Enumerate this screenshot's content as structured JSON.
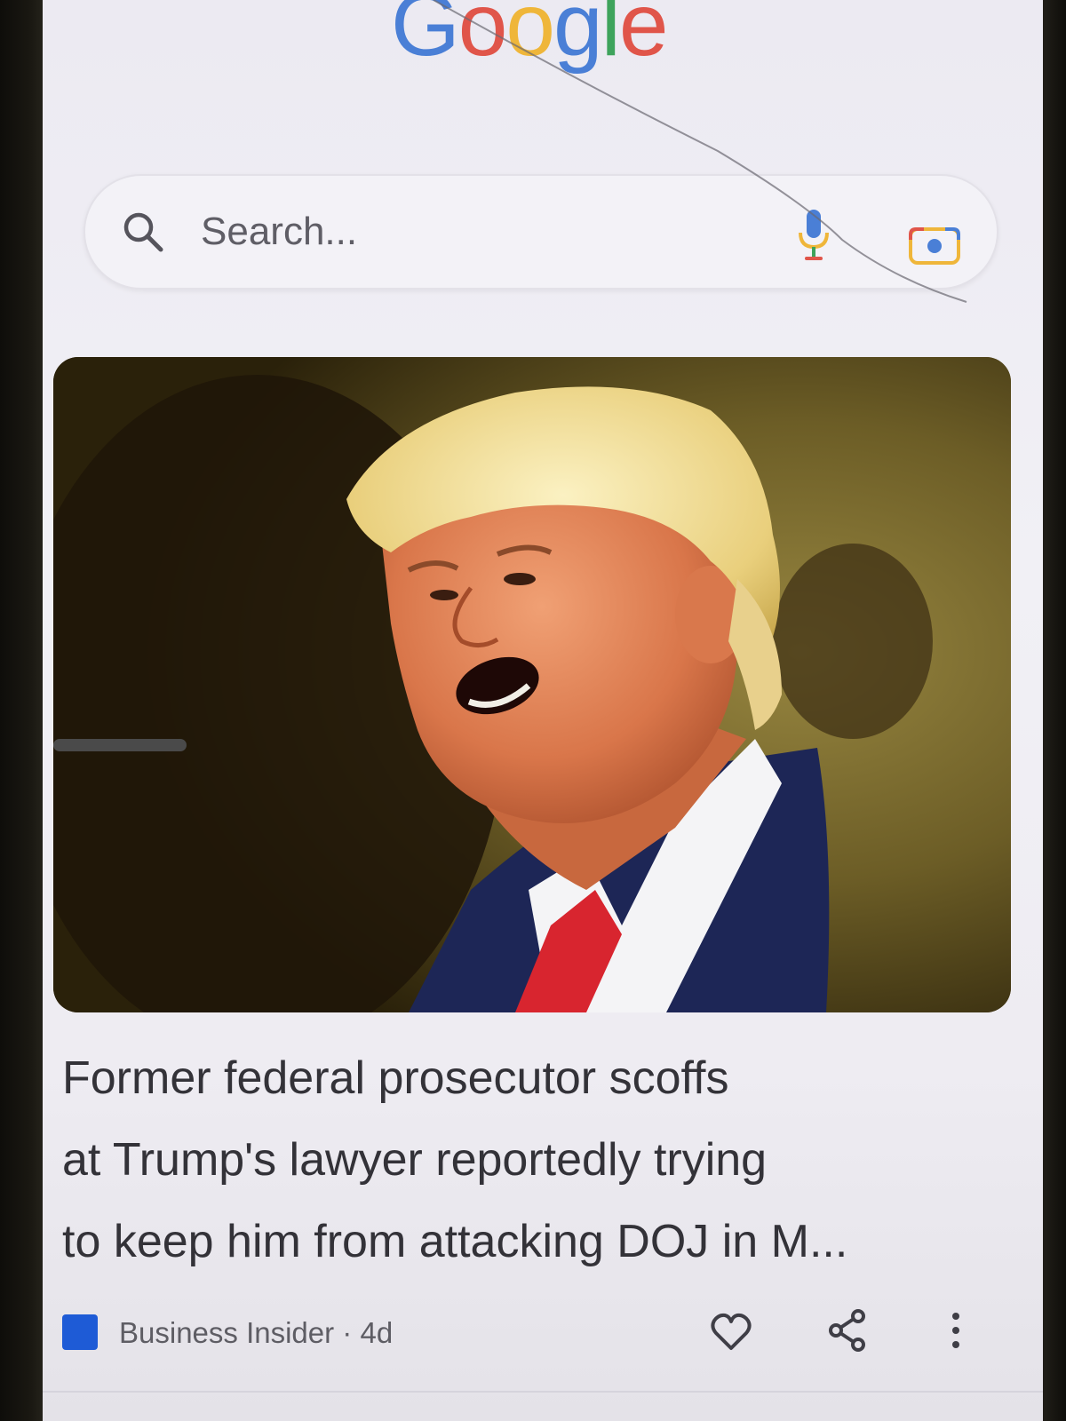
{
  "logo": {
    "letters": [
      {
        "ch": "G",
        "color": "#4a7fd6"
      },
      {
        "ch": "o",
        "color": "#e0554a"
      },
      {
        "ch": "o",
        "color": "#efb63a"
      },
      {
        "ch": "g",
        "color": "#4a7fd6"
      },
      {
        "ch": "l",
        "color": "#3ea35c"
      },
      {
        "ch": "e",
        "color": "#e0554a"
      }
    ]
  },
  "search": {
    "placeholder": "Search..."
  },
  "card": {
    "headline_lines": [
      "Former federal prosecutor scoffs",
      "at Trump's lawyer reportedly trying",
      "to keep him from attacking DOJ in M..."
    ],
    "source": "Business Insider",
    "separator": "·",
    "age": "4d"
  },
  "colors": {
    "google_blue": "#4a7fd6",
    "google_red": "#e0554a",
    "google_yellow": "#efb63a",
    "google_green": "#3ea35c",
    "source_logo": "#1e5bd6"
  },
  "icons": {
    "search": "search-icon",
    "mic": "microphone-icon",
    "lens": "camera-lens-icon",
    "like": "heart-icon",
    "share": "share-icon",
    "more": "more-vertical-icon"
  }
}
